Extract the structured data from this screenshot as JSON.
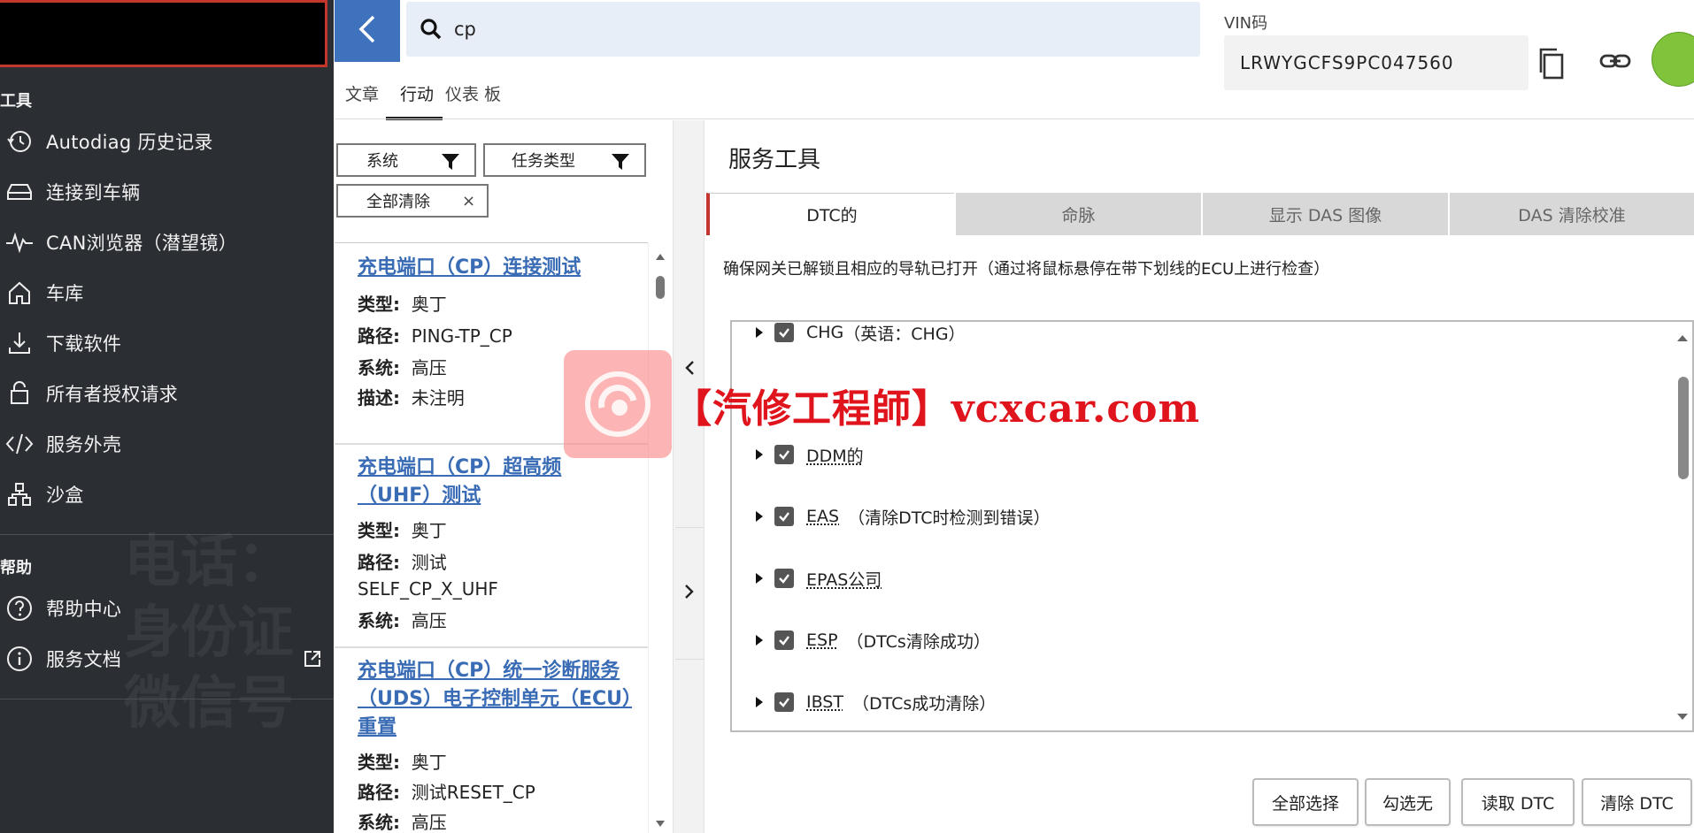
{
  "sidebar": {
    "tools_heading": "工具",
    "tools": [
      {
        "label": "Autodiag 历史记录",
        "icon": "history-icon"
      },
      {
        "label": "连接到车辆",
        "icon": "car-icon"
      },
      {
        "label": "CAN浏览器（潜望镜）",
        "icon": "pulse-icon"
      },
      {
        "label": "车库",
        "icon": "home-icon"
      },
      {
        "label": "下载软件",
        "icon": "download-icon"
      },
      {
        "label": "所有者授权请求",
        "icon": "owner-icon"
      },
      {
        "label": "服务外壳",
        "icon": "code-icon"
      },
      {
        "label": "沙盒",
        "icon": "sandbox-icon"
      }
    ],
    "help_heading": "帮助",
    "help": [
      {
        "label": "帮助中心",
        "icon": "help-icon"
      },
      {
        "label": "服务文档",
        "icon": "info-icon"
      }
    ],
    "watermark_lines": [
      "电话：",
      "身份证",
      "微信号"
    ]
  },
  "search": {
    "value": "cp"
  },
  "vin": {
    "label": "VIN码",
    "value": "LRWYGCFS9PC047560"
  },
  "tabs": [
    "文章",
    "行动",
    "仪表 板"
  ],
  "filters": {
    "system": "系统",
    "task_type": "任务类型",
    "clear_all": "全部清除",
    "clear_x": "×"
  },
  "results": [
    {
      "title": "充电端口（CP）连接测试",
      "rows": [
        {
          "k": "类型:",
          "v": "奥丁"
        },
        {
          "k": "路径:",
          "v": "PING-TP_CP"
        },
        {
          "k": "系统:",
          "v": "高压"
        },
        {
          "k": "描述:",
          "v": "未注明"
        }
      ]
    },
    {
      "title": "充电端口（CP）超高频（UHF）测试",
      "rows": [
        {
          "k": "类型:",
          "v": "奥丁"
        },
        {
          "k": "路径:",
          "v": "测试"
        },
        {
          "k": "",
          "v": "SELF_CP_X_UHF"
        },
        {
          "k": "系统:",
          "v": "高压"
        }
      ]
    },
    {
      "title": "充电端口（CP）统一诊断服务（UDS）电子控制单元（ECU）重置",
      "rows": [
        {
          "k": "类型:",
          "v": "奥丁"
        },
        {
          "k": "路径:",
          "v": "测试RESET_CP"
        },
        {
          "k": "系统:",
          "v": "高压"
        }
      ]
    }
  ],
  "panel": {
    "title": "服务工具",
    "tabs": [
      "DTC的",
      "命脉",
      "显示 DAS 图像",
      "DAS 清除校准"
    ],
    "instruction": "确保网关已解锁且相应的导轨已打开（通过将鼠标悬停在带下划线的ECU上进行检查）",
    "ecus": [
      {
        "code": "CHG",
        "note": "（英语：CHG）",
        "underline": false
      },
      {
        "code": "DDM的",
        "note": "",
        "underline": true
      },
      {
        "code": "EAS",
        "note": "（清除DTC时检测到错误）",
        "underline": true
      },
      {
        "code": "EPAS公司",
        "note": "",
        "underline": true
      },
      {
        "code": "ESP",
        "note": "（DTCs清除成功）",
        "underline": true
      },
      {
        "code": "IBST",
        "note": "（DTCs成功清除）",
        "underline": true
      }
    ],
    "buttons": [
      "全部选择",
      "勾选无",
      "读取 DTC",
      "清除 DTC"
    ]
  },
  "watermark": {
    "text": "【汽修工程師】vcxcar.com"
  },
  "colors": {
    "sidebar_bg": "#2b2e33",
    "accent_blue": "#3e72bd",
    "link_blue": "#3a6cb5",
    "active_tab_marker": "#c3362b",
    "status_green": "#7fc43a",
    "watermark_red": "#e0141c"
  }
}
